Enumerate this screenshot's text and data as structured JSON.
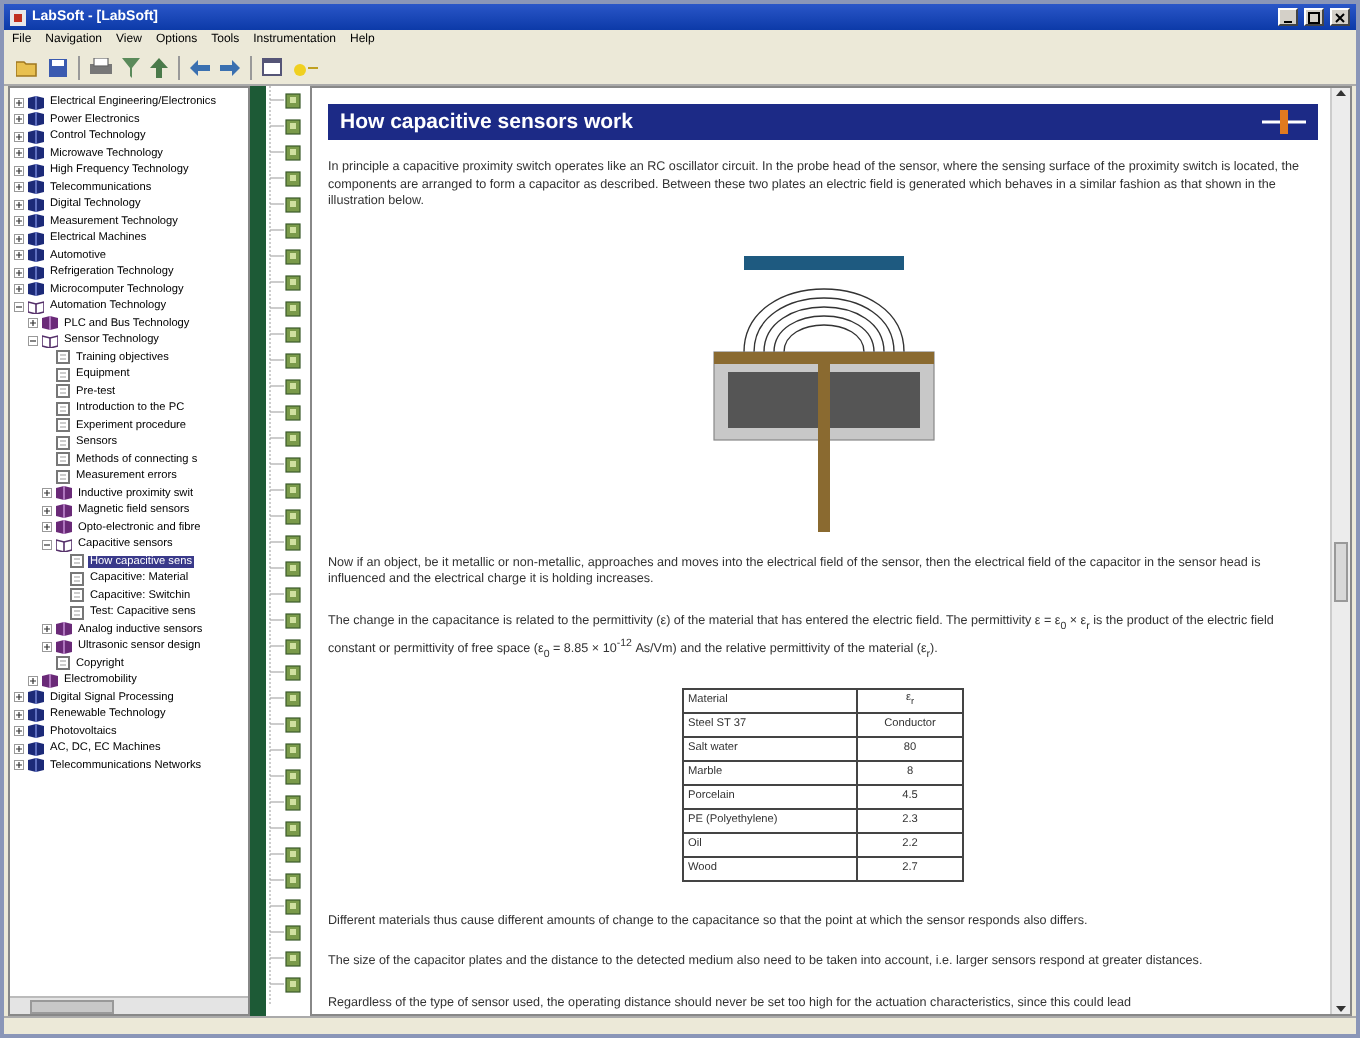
{
  "window": {
    "title": "LabSoft - [LabSoft]"
  },
  "menu": [
    "File",
    "Navigation",
    "View",
    "Options",
    "Tools",
    "Instrumentation",
    "Help"
  ],
  "tree": [
    {
      "label": "Electrical Engineering/Electronics",
      "kind": "book",
      "expanded": false,
      "selected": false
    },
    {
      "label": "Power Electronics",
      "kind": "book",
      "expanded": false,
      "selected": false
    },
    {
      "label": "Control Technology",
      "kind": "book",
      "expanded": false,
      "selected": false
    },
    {
      "label": "Microwave Technology",
      "kind": "book",
      "expanded": false,
      "selected": false
    },
    {
      "label": "High Frequency Technology",
      "kind": "book",
      "expanded": false,
      "selected": false
    },
    {
      "label": "Telecommunications",
      "kind": "book",
      "expanded": false,
      "selected": false
    },
    {
      "label": "Digital Technology",
      "kind": "book",
      "expanded": false,
      "selected": false
    },
    {
      "label": "Measurement Technology",
      "kind": "book",
      "expanded": false,
      "selected": false
    },
    {
      "label": "Electrical Machines",
      "kind": "book",
      "expanded": false,
      "selected": false
    },
    {
      "label": "Automotive",
      "kind": "book",
      "expanded": false,
      "selected": false
    },
    {
      "label": "Refrigeration Technology",
      "kind": "book",
      "expanded": false,
      "selected": false
    },
    {
      "label": "Microcomputer Technology",
      "kind": "book",
      "expanded": false,
      "selected": false
    },
    {
      "label": "Automation Technology",
      "kind": "open",
      "expanded": true,
      "selected": false,
      "children": [
        {
          "label": "PLC and Bus Technology",
          "kind": "chapter",
          "expanded": false,
          "selected": false
        },
        {
          "label": "Sensor Technology",
          "kind": "open",
          "expanded": true,
          "selected": false,
          "children": [
            {
              "label": "Training objectives",
              "kind": "page",
              "selected": false
            },
            {
              "label": "Equipment",
              "kind": "page",
              "selected": false
            },
            {
              "label": "Pre-test",
              "kind": "page",
              "selected": false
            },
            {
              "label": "Introduction to the PC",
              "kind": "page",
              "selected": false
            },
            {
              "label": "Experiment procedure",
              "kind": "page",
              "selected": false
            },
            {
              "label": "Sensors",
              "kind": "page",
              "selected": false
            },
            {
              "label": "Methods of connecting s",
              "kind": "page",
              "selected": false
            },
            {
              "label": "Measurement errors",
              "kind": "page",
              "selected": false
            },
            {
              "label": "Inductive proximity swit",
              "kind": "chapter",
              "expanded": false,
              "selected": false
            },
            {
              "label": "Magnetic field sensors",
              "kind": "chapter",
              "expanded": false,
              "selected": false
            },
            {
              "label": "Opto-electronic and fibre",
              "kind": "chapter",
              "expanded": false,
              "selected": false
            },
            {
              "label": "Capacitive sensors",
              "kind": "open",
              "expanded": true,
              "selected": false,
              "children": [
                {
                  "label": "How capacitive sens",
                  "kind": "page",
                  "selected": true
                },
                {
                  "label": "Capacitive: Material",
                  "kind": "page",
                  "selected": false
                },
                {
                  "label": "Capacitive: Switchin",
                  "kind": "page",
                  "selected": false
                },
                {
                  "label": "Test: Capacitive sens",
                  "kind": "page",
                  "selected": false
                }
              ]
            },
            {
              "label": "Analog inductive sensors",
              "kind": "chapter",
              "expanded": false,
              "selected": false
            },
            {
              "label": "Ultrasonic sensor design",
              "kind": "chapter",
              "expanded": false,
              "selected": false
            },
            {
              "label": "Copyright",
              "kind": "page",
              "selected": false
            }
          ]
        },
        {
          "label": "Electromobility",
          "kind": "chapter",
          "expanded": false,
          "selected": false
        }
      ]
    },
    {
      "label": "Digital Signal Processing",
      "kind": "book",
      "expanded": false,
      "selected": false
    },
    {
      "label": "Renewable Technology",
      "kind": "book",
      "expanded": false,
      "selected": false
    },
    {
      "label": "Photovoltaics",
      "kind": "book",
      "expanded": false,
      "selected": false
    },
    {
      "label": "AC, DC, EC Machines",
      "kind": "book",
      "expanded": false,
      "selected": false
    },
    {
      "label": "Telecommunications Networks",
      "kind": "book",
      "expanded": false,
      "selected": false
    }
  ],
  "article": {
    "heading": "How capacitive sensors work",
    "blocks": [
      {
        "kind": "paragraph",
        "text": "In principle a capacitive proximity switch operates like an RC oscillator circuit. In the probe head of the sensor, where the sensing surface of the proximity switch is located, the components are arranged to form a capacitor as described. Between these two plates an electric field is generated which behaves in a similar fashion as that shown in the illustration below."
      },
      {
        "kind": "figure"
      },
      {
        "kind": "paragraph",
        "text": "Now if an object, be it metallic or non-metallic, approaches and moves into the electrical field of the sensor, then the electrical field of the capacitor in the sensor head is influenced and the electrical charge it is holding increases."
      },
      {
        "kind": "paragraph",
        "text": "The change in the capacitance is related to the permittivity (ε) of the material that has entered the electric field. The permittivity ε = ε$_{0}$ × ε$_{r}$ is the product of the electric field constant or permittivity of free space (ε$_{0}$ = 8.85 × 10$^{-12}$ As/Vm) and the relative permittivity of the material (ε$_{r}$)."
      },
      {
        "kind": "table",
        "columns": [
          "Material",
          "ε$_{r}$"
        ],
        "rows": [
          [
            "Steel ST 37",
            "Conductor"
          ],
          [
            "Salt water",
            "80"
          ],
          [
            "Marble",
            "8"
          ],
          [
            "Porcelain",
            "4.5"
          ],
          [
            "PE (Polyethylene)",
            "2.3"
          ],
          [
            "Oil",
            "2.2"
          ],
          [
            "Wood",
            "2.7"
          ]
        ]
      },
      {
        "kind": "paragraph",
        "text": "Different materials thus cause different amounts of change to the capacitance so that the point at which the sensor responds also differs."
      },
      {
        "kind": "paragraph",
        "text": "The size of the capacitor plates and the distance to the detected medium also need to be taken into account, i.e. larger sensors respond at greater distances."
      },
      {
        "kind": "paragraph",
        "text": "Regardless of the type of sensor used, the operating distance should never be set too high for the actuation characteristics, since this could lead"
      }
    ]
  }
}
